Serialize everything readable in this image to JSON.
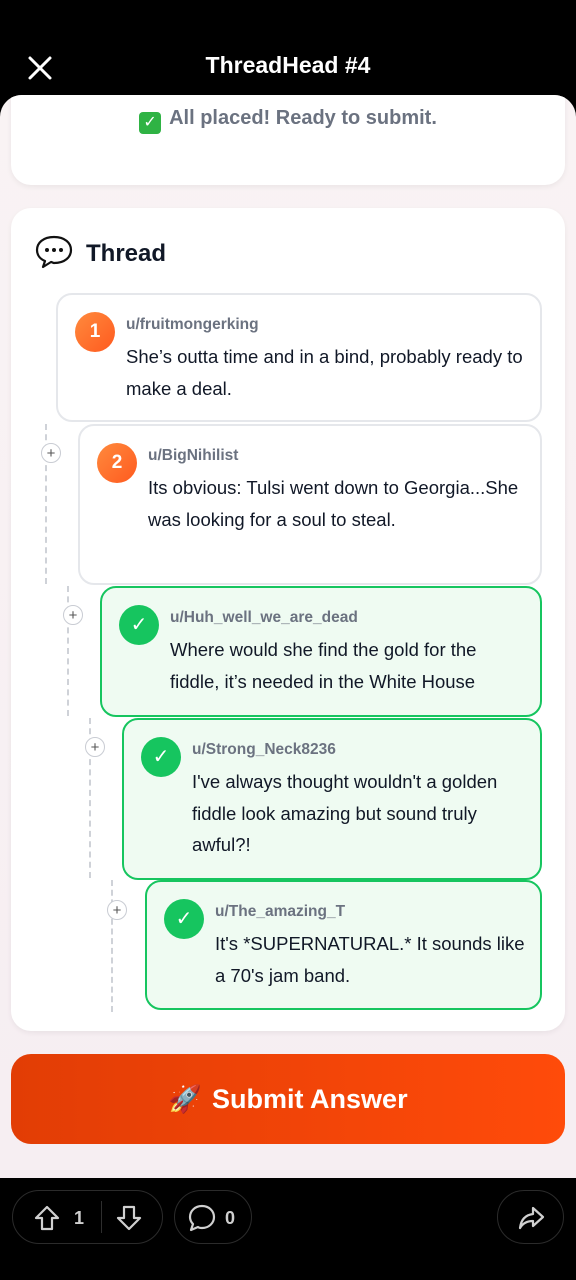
{
  "header": {
    "title": "ThreadHead #4"
  },
  "status": {
    "check": "✓",
    "text": "All placed! Ready to submit."
  },
  "thread": {
    "title": "Thread",
    "comments": [
      {
        "badge": "1",
        "user": "u/fruitmongerking",
        "text": "She’s outta time and in a bind, probably ready to make a deal."
      },
      {
        "badge": "2",
        "user": "u/BigNihilist",
        "text": "Its obvious: Tulsi went down to Georgia...She was looking for a soul to steal."
      },
      {
        "badge": "✓",
        "user": "u/Huh_well_we_are_dead",
        "text": "Where would she find the gold for the fiddle, it’s needed in the White House"
      },
      {
        "badge": "✓",
        "user": "u/Strong_Neck8236",
        "text": "I've always thought wouldn't a golden fiddle look amazing but sound truly awful?!"
      },
      {
        "badge": "✓",
        "user": "u/The_amazing_T",
        "text": "It's *SUPERNATURAL.* It sounds like a 70's jam band."
      }
    ],
    "expand_symbol": "+"
  },
  "submit": {
    "icon": "🚀",
    "label": "Submit Answer"
  },
  "bottom_bar": {
    "upvotes": "1",
    "comments": "0"
  },
  "colors": {
    "accent": "#ff4500",
    "placed": "#16c55f",
    "badge": "#ff6a2b"
  },
  "icons": [
    "close-icon",
    "speech-bubble-icon",
    "rocket-icon",
    "upvote-icon",
    "downvote-icon",
    "comment-icon",
    "share-icon"
  ]
}
